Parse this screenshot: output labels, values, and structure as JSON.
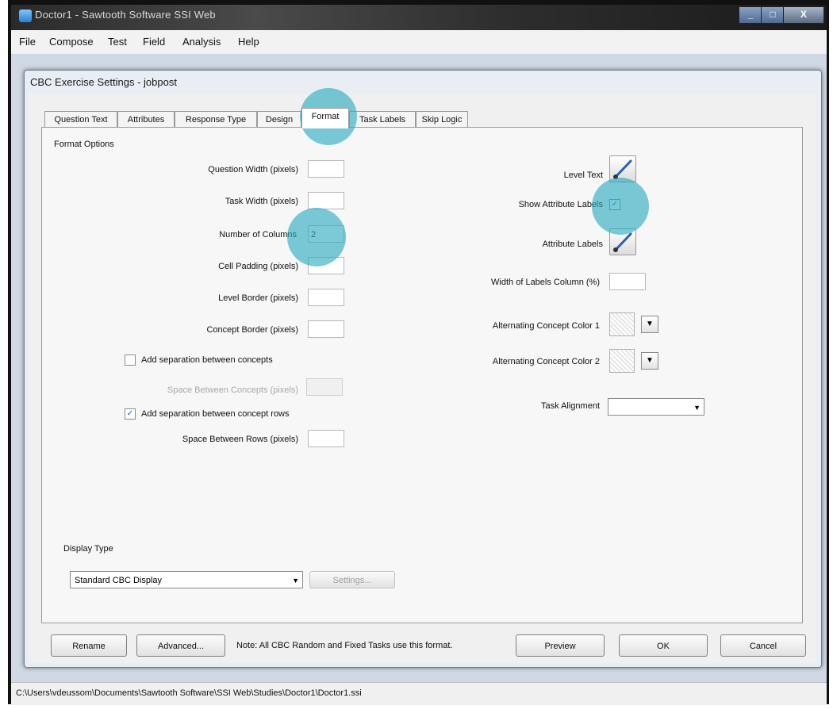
{
  "window": {
    "title": "Doctor1 - Sawtooth Software SSI Web",
    "min": "_",
    "max": "□",
    "close": "X"
  },
  "menu": [
    "File",
    "Compose",
    "Test",
    "Field",
    "Analysis",
    "Help"
  ],
  "dialog": {
    "title": "CBC Exercise Settings - jobpost",
    "tabs": [
      "Question Text",
      "Attributes",
      "Response Type",
      "Design",
      "Format",
      "Task Labels",
      "Skip Logic"
    ],
    "active_tab": "Format",
    "format_options": {
      "legend": "Format Options",
      "question_width": {
        "label": "Question Width (pixels)",
        "value": ""
      },
      "task_width": {
        "label": "Task Width (pixels)",
        "value": ""
      },
      "number_of_columns": {
        "label": "Number of Columns",
        "value": "2"
      },
      "cell_padding": {
        "label": "Cell Padding (pixels)",
        "value": ""
      },
      "level_border": {
        "label": "Level Border (pixels)",
        "value": ""
      },
      "concept_border": {
        "label": "Concept Border (pixels)",
        "value": ""
      },
      "add_sep_concepts": {
        "label": "Add separation between concepts",
        "checked": false
      },
      "space_between_concepts": {
        "label": "Space Between Concepts (pixels)",
        "value": ""
      },
      "add_sep_rows": {
        "label": "Add separation between concept rows",
        "checked": true,
        "mark": "✓"
      },
      "space_between_rows": {
        "label": "Space Between Rows (pixels)",
        "value": ""
      },
      "level_text": {
        "label": "Level Text"
      },
      "show_attribute_labels": {
        "label": "Show Attribute Labels",
        "checked": true,
        "mark": "✓"
      },
      "attribute_labels": {
        "label": "Attribute Labels"
      },
      "width_labels_column": {
        "label": "Width of Labels Column (%)",
        "value": ""
      },
      "alt_color_1": {
        "label": "Alternating Concept Color 1",
        "arrow": "▼"
      },
      "alt_color_2": {
        "label": "Alternating Concept Color 2",
        "arrow": "▼"
      },
      "task_alignment": {
        "label": "Task Alignment",
        "value": "",
        "arrow": "▼"
      }
    },
    "display_type": {
      "legend": "Display Type",
      "selected": "Standard CBC Display",
      "arrow": "▼",
      "settings_label": "Settings..."
    },
    "footer": {
      "rename": "Rename",
      "advanced": "Advanced...",
      "note": "Note:  All CBC Random and Fixed Tasks use this format.",
      "preview": "Preview",
      "ok": "OK",
      "cancel": "Cancel"
    }
  },
  "status": "C:\\Users\\vdeussom\\Documents\\Sawtooth Software\\SSI Web\\Studies\\Doctor1\\Doctor1.ssi",
  "colors": {
    "highlight": "#28aabe",
    "titlebar": "#2e2e2e",
    "dialog_bg": "#f0f0f0"
  }
}
